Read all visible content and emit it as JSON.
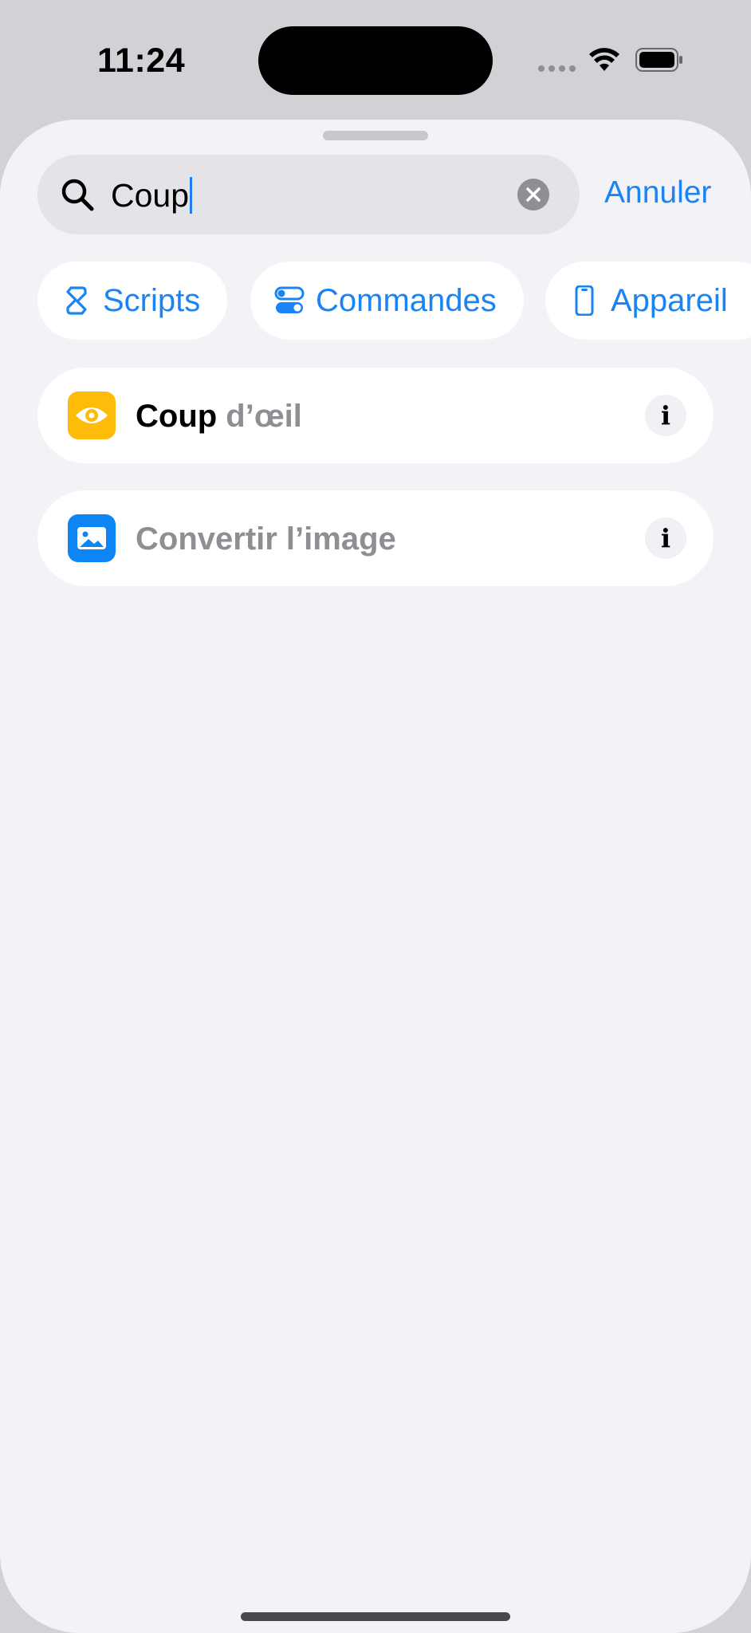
{
  "status_bar": {
    "time": "11:24",
    "icons": [
      "signal-dots-icon",
      "wifi-icon",
      "battery-icon"
    ]
  },
  "search": {
    "value": "Coup",
    "cancel_label": "Annuler"
  },
  "chips": [
    {
      "label": "Scripts",
      "icon": "scripts-icon"
    },
    {
      "label": "Commandes",
      "icon": "toggles-icon"
    },
    {
      "label": "Appareil",
      "icon": "iphone-icon"
    }
  ],
  "results": [
    {
      "match": "Coup",
      "rest": " d’œil",
      "icon": "eye-icon",
      "icon_color": "#ffbb0a"
    },
    {
      "match": "",
      "rest": "Convertir l’image",
      "icon": "photo-icon",
      "icon_color": "#0d85f5"
    }
  ],
  "info_glyph": "i",
  "colors": {
    "accent": "#1a84f5",
    "sheet_background": "#f2f2f7",
    "secondary_text": "#8e8e93"
  }
}
